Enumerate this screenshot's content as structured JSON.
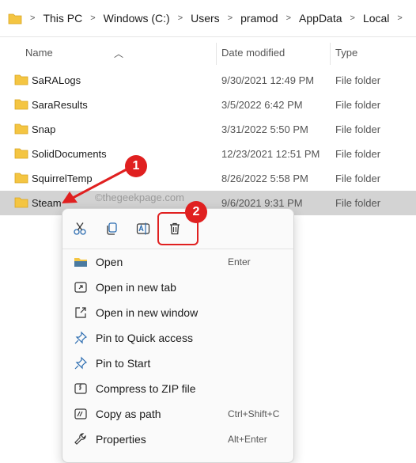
{
  "breadcrumb": {
    "items": [
      "This PC",
      "Windows (C:)",
      "Users",
      "pramod",
      "AppData",
      "Local"
    ],
    "sep": ">"
  },
  "columns": {
    "name": "Name",
    "date_modified": "Date modified",
    "type": "Type"
  },
  "rows": [
    {
      "name": "SaRALogs",
      "date": "9/30/2021 12:49 PM",
      "type": "File folder"
    },
    {
      "name": "SaraResults",
      "date": "3/5/2022 6:42 PM",
      "type": "File folder"
    },
    {
      "name": "Snap",
      "date": "3/31/2022 5:50 PM",
      "type": "File folder"
    },
    {
      "name": "SolidDocuments",
      "date": "12/23/2021 12:51 PM",
      "type": "File folder"
    },
    {
      "name": "SquirrelTemp",
      "date": "8/26/2022 5:58 PM",
      "type": "File folder"
    },
    {
      "name": "Steam",
      "date": "9/6/2021 9:31 PM",
      "type": "File folder"
    }
  ],
  "watermark": "©thegeekpage.com",
  "context_menu": {
    "items": [
      {
        "label": "Open",
        "shortcut": "Enter"
      },
      {
        "label": "Open in new tab",
        "shortcut": ""
      },
      {
        "label": "Open in new window",
        "shortcut": ""
      },
      {
        "label": "Pin to Quick access",
        "shortcut": ""
      },
      {
        "label": "Pin to Start",
        "shortcut": ""
      },
      {
        "label": "Compress to ZIP file",
        "shortcut": ""
      },
      {
        "label": "Copy as path",
        "shortcut": "Ctrl+Shift+C"
      },
      {
        "label": "Properties",
        "shortcut": "Alt+Enter"
      }
    ]
  },
  "annotations": {
    "step1": "1",
    "step2": "2"
  },
  "colors": {
    "accent_red": "#e02020",
    "folder_yellow": "#f4c542",
    "selection": "#d3d3d3"
  }
}
